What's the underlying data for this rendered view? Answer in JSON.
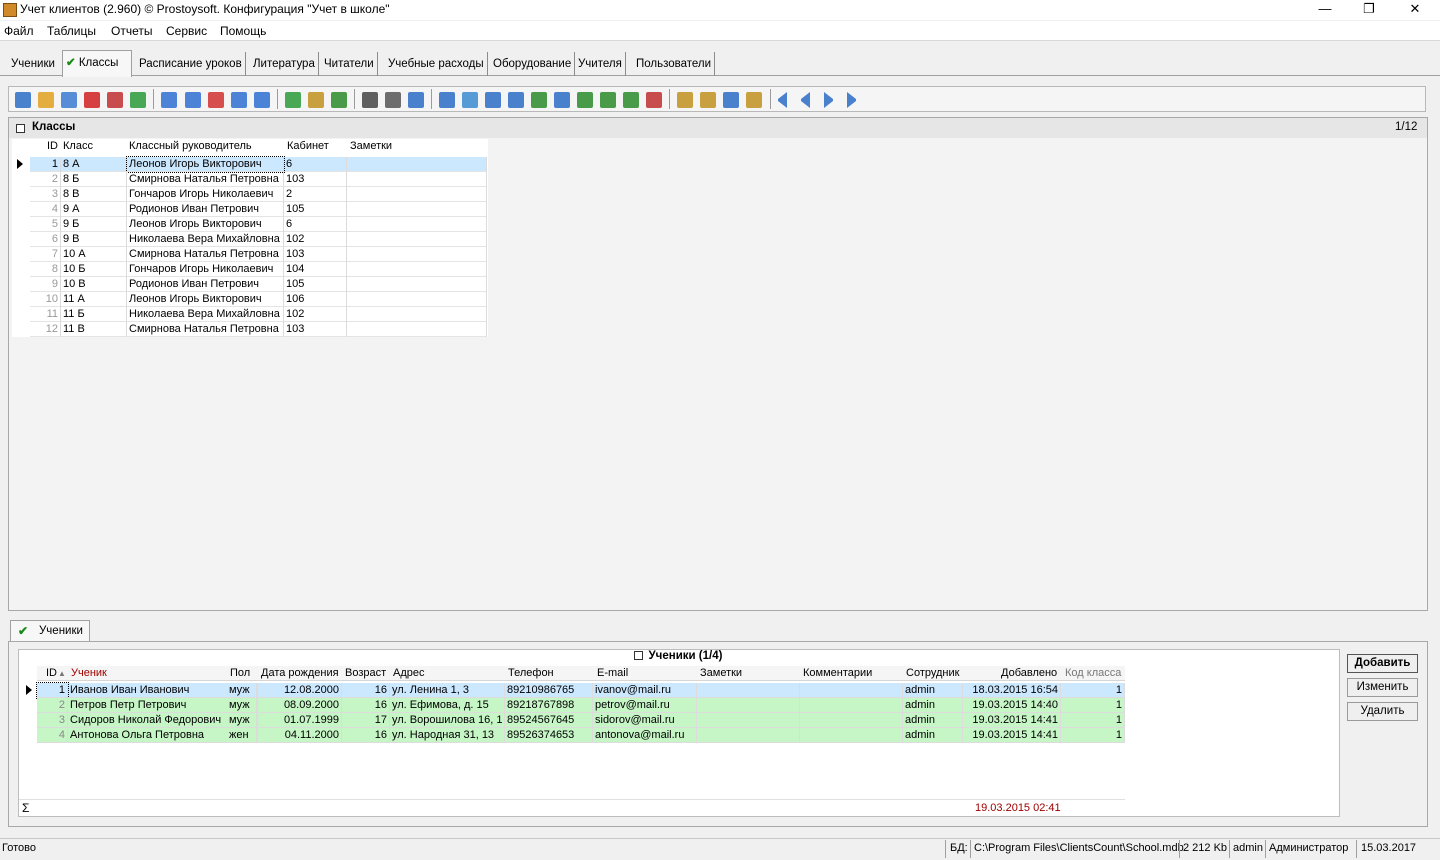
{
  "window": {
    "title": "Учет клиентов (2.960) © Prostoysoft. Конфигурация \"Учет в школе\"",
    "minimize": "—",
    "maximize": "❐",
    "close": "✕"
  },
  "menu": [
    "Файл",
    "Таблицы",
    "Отчеты",
    "Сервис",
    "Помощь"
  ],
  "tabs": [
    "Ученики",
    "Классы",
    "Расписание уроков",
    "Литература",
    "Читатели",
    "Учебные расходы",
    "Оборудование",
    "Учителя",
    "Пользователи"
  ],
  "active_tab": "Классы",
  "toolbar_icons": [
    "add-record-icon",
    "edit-icon",
    "copy-icon",
    "delete-icon",
    "table-icon",
    "refresh-icon",
    "filter-icon",
    "filter-add-icon",
    "filter-remove-icon",
    "filter-clear-icon",
    "filter-edit-icon",
    "filter-green-icon",
    "filter-group-icon",
    "sql-icon",
    "find-icon",
    "print-icon",
    "preview-icon",
    "export-1-icon",
    "export-2-icon",
    "export-3-icon",
    "export-word-icon",
    "export-excel-icon",
    "export-4-icon",
    "export-csv-icon",
    "export-5-icon",
    "export-6-icon",
    "chart-icon",
    "report-1-icon",
    "report-2-icon",
    "report-3-icon",
    "report-4-icon",
    "first-record-icon",
    "prev-record-icon",
    "next-record-icon",
    "last-record-icon"
  ],
  "top": {
    "title": "Классы",
    "count": "1/12",
    "columns": [
      "ID",
      "Класс",
      "Классный руководитель",
      "Кабинет",
      "Заметки"
    ],
    "rows": [
      [
        "1",
        "8 А",
        "Леонов Игорь Викторович",
        "6",
        ""
      ],
      [
        "2",
        "8 Б",
        "Смирнова Наталья Петровна",
        "103",
        ""
      ],
      [
        "3",
        "8 В",
        "Гончаров Игорь Николаевич",
        "2",
        ""
      ],
      [
        "4",
        "9 А",
        "Родионов Иван Петрович",
        "105",
        ""
      ],
      [
        "5",
        "9 Б",
        "Леонов Игорь Викторович",
        "6",
        ""
      ],
      [
        "6",
        "9 В",
        "Николаева Вера Михайловна",
        "102",
        ""
      ],
      [
        "7",
        "10 А",
        "Смирнова Наталья Петровна",
        "103",
        ""
      ],
      [
        "8",
        "10 Б",
        "Гончаров Игорь Николаевич",
        "104",
        ""
      ],
      [
        "9",
        "10 В",
        "Родионов Иван Петрович",
        "105",
        ""
      ],
      [
        "10",
        "11 А",
        "Леонов Игорь Викторович",
        "106",
        ""
      ],
      [
        "11",
        "11 Б",
        "Николаева Вера Михайловна",
        "102",
        ""
      ],
      [
        "12",
        "11 В",
        "Смирнова Наталья Петровна",
        "103",
        ""
      ]
    ]
  },
  "bottom": {
    "tab": "Ученики",
    "title": "Ученики (1/4)",
    "columns": [
      "ID",
      "Ученик",
      "Пол",
      "Дата рождения",
      "Возраст",
      "Адрес",
      "Телефон",
      "E-mail",
      "Заметки",
      "Комментарии",
      "Сотрудник",
      "Добавлено",
      "Код класса"
    ],
    "rows": [
      [
        "1",
        "Иванов Иван Иванович",
        "муж",
        "12.08.2000",
        "16",
        "ул. Ленина 1, 3",
        "89210986765",
        "ivanov@mail.ru",
        "",
        "",
        "admin",
        "18.03.2015 16:54",
        "1"
      ],
      [
        "2",
        "Петров Петр Петрович",
        "муж",
        "08.09.2000",
        "16",
        "ул. Ефимова, д. 15",
        "89218767898",
        "petrov@mail.ru",
        "",
        "",
        "admin",
        "19.03.2015 14:40",
        "1"
      ],
      [
        "3",
        "Сидоров Николай Федорович",
        "муж",
        "01.07.1999",
        "17",
        "ул. Ворошилова 16, 1",
        "89524567645",
        "sidorov@mail.ru",
        "",
        "",
        "admin",
        "19.03.2015 14:41",
        "1"
      ],
      [
        "4",
        "Антонова Ольга Петровна",
        "жен",
        "04.11.2000",
        "16",
        "ул. Народная 31, 13",
        "89526374653",
        "antonova@mail.ru",
        "",
        "",
        "admin",
        "19.03.2015 14:41",
        "1"
      ]
    ],
    "sum_symbol": "Σ",
    "sum_added": "19.03.2015 02:41",
    "buttons": {
      "add": "Добавить",
      "edit": "Изменить",
      "delete": "Удалить"
    }
  },
  "status": {
    "ready": "Готово",
    "db_label": "БД:",
    "db_path": "C:\\Program Files\\ClientsCount\\School.mdb",
    "size": "2 212 Kb",
    "user": "admin",
    "role": "Администратор",
    "date": "15.03.2017"
  },
  "colors": {
    "selected_row": "#cce8ff",
    "student_row": "#c6f5c6",
    "title_accent": "#a00000",
    "check": "#178a17"
  }
}
